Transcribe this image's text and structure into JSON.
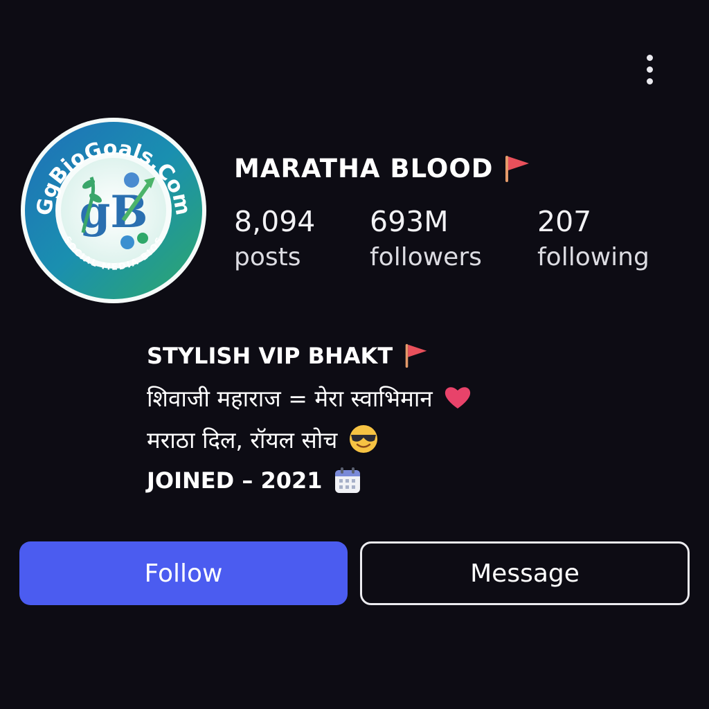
{
  "profile": {
    "display_name": "MARATHA BLOOD",
    "avatar": {
      "logo_text": "GgBioGoals.Com",
      "tagline": "SOCIAL MEDIA BIOS",
      "monogram": "gB"
    }
  },
  "stats": [
    {
      "count": "8,094",
      "label": "posts"
    },
    {
      "count": "693M",
      "label": "followers"
    },
    {
      "count": "207",
      "label": "following"
    }
  ],
  "bio": {
    "line1": "STYLISH VIP BHAKT",
    "line2": "शिवाजी महाराज = मेरा स्वाभिमान",
    "line3": "मराठा दिल, रॉयल सोच",
    "line4": "JOINED – 2021"
  },
  "icons": {
    "flag": "red-flag-icon",
    "heart": "red-heart-icon",
    "sunglasses": "smiling-face-with-sunglasses-icon",
    "calendar": "calendar-icon",
    "menu": "more-options-icon"
  },
  "actions": {
    "follow_label": "Follow",
    "message_label": "Message"
  },
  "colors": {
    "background": "#0d0c14",
    "follow_button": "#4b5cf0",
    "flag": "#e8505b"
  }
}
